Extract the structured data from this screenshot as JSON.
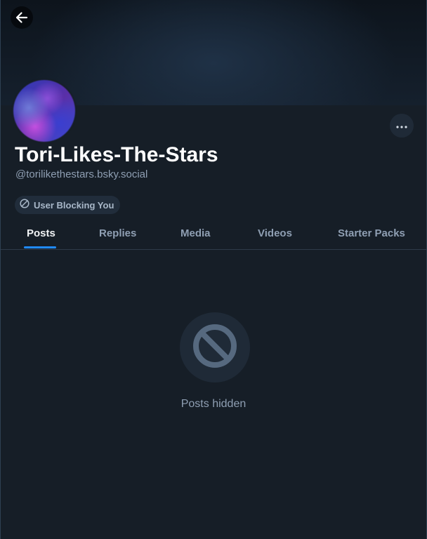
{
  "profile": {
    "display_name": "Tori-Likes-The-Stars",
    "handle": "@torilikethestars.bsky.social",
    "block_badge": "User Blocking You"
  },
  "tabs": [
    {
      "label": "Posts",
      "active": true
    },
    {
      "label": "Replies",
      "active": false
    },
    {
      "label": "Media",
      "active": false
    },
    {
      "label": "Videos",
      "active": false
    },
    {
      "label": "Starter Packs",
      "active": false
    }
  ],
  "feed": {
    "empty_message": "Posts hidden",
    "empty_icon": "circle-ban-icon"
  },
  "colors": {
    "background": "#161e27",
    "accent": "#208bfe",
    "muted_text": "#8f9fb3"
  },
  "icons": {
    "back": "arrow-left-icon",
    "more": "ellipsis-icon",
    "blocked": "circle-ban-icon"
  }
}
